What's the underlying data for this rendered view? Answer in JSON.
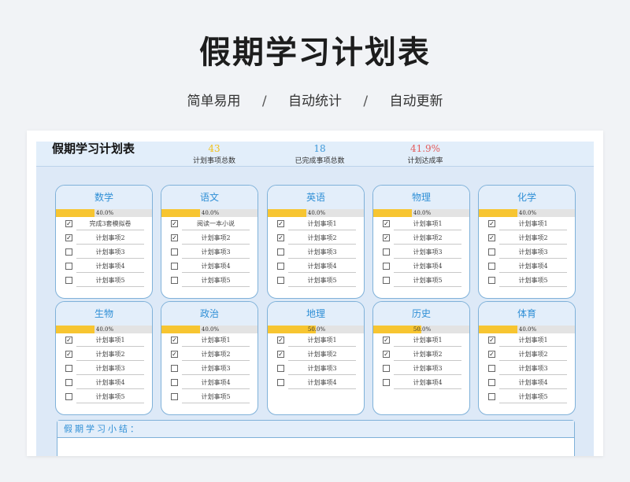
{
  "hero": {
    "title": "假期学习计划表",
    "features": [
      "简单易用",
      "自动统计",
      "自动更新"
    ],
    "separator": "/"
  },
  "sheet": {
    "title": "假期学习计划表",
    "stats": [
      {
        "value": "43",
        "label": "计划事项总数",
        "color": "#f2c018"
      },
      {
        "value": "18",
        "label": "已完成事项总数",
        "color": "#3c98d9"
      },
      {
        "value": "41.9%",
        "label": "计划达成率",
        "color": "#e35d5d"
      }
    ],
    "check_mark": "✓",
    "subjects": [
      {
        "name": "数学",
        "progress": 0.4,
        "progress_label": "40.0%",
        "items": [
          {
            "text": "完成3套模拟卷",
            "checked": true
          },
          {
            "text": "计划事项2",
            "checked": true
          },
          {
            "text": "计划事项3",
            "checked": false
          },
          {
            "text": "计划事项4",
            "checked": false
          },
          {
            "text": "计划事项5",
            "checked": false
          }
        ]
      },
      {
        "name": "语文",
        "progress": 0.4,
        "progress_label": "40.0%",
        "items": [
          {
            "text": "阅读一本小说",
            "checked": true
          },
          {
            "text": "计划事项2",
            "checked": true
          },
          {
            "text": "计划事项3",
            "checked": false
          },
          {
            "text": "计划事项4",
            "checked": false
          },
          {
            "text": "计划事项5",
            "checked": false
          }
        ]
      },
      {
        "name": "英语",
        "progress": 0.4,
        "progress_label": "40.0%",
        "items": [
          {
            "text": "计划事项1",
            "checked": true
          },
          {
            "text": "计划事项2",
            "checked": true
          },
          {
            "text": "计划事项3",
            "checked": false
          },
          {
            "text": "计划事项4",
            "checked": false
          },
          {
            "text": "计划事项5",
            "checked": false
          }
        ]
      },
      {
        "name": "物理",
        "progress": 0.4,
        "progress_label": "40.0%",
        "items": [
          {
            "text": "计划事项1",
            "checked": true
          },
          {
            "text": "计划事项2",
            "checked": true
          },
          {
            "text": "计划事项3",
            "checked": false
          },
          {
            "text": "计划事项4",
            "checked": false
          },
          {
            "text": "计划事项5",
            "checked": false
          }
        ]
      },
      {
        "name": "化学",
        "progress": 0.4,
        "progress_label": "40.0%",
        "items": [
          {
            "text": "计划事项1",
            "checked": true
          },
          {
            "text": "计划事项2",
            "checked": true
          },
          {
            "text": "计划事项3",
            "checked": false
          },
          {
            "text": "计划事项4",
            "checked": false
          },
          {
            "text": "计划事项5",
            "checked": false
          }
        ]
      },
      {
        "name": "生物",
        "progress": 0.4,
        "progress_label": "40.0%",
        "items": [
          {
            "text": "计划事项1",
            "checked": true
          },
          {
            "text": "计划事项2",
            "checked": true
          },
          {
            "text": "计划事项3",
            "checked": false
          },
          {
            "text": "计划事项4",
            "checked": false
          },
          {
            "text": "计划事项5",
            "checked": false
          }
        ]
      },
      {
        "name": "政治",
        "progress": 0.4,
        "progress_label": "40.0%",
        "items": [
          {
            "text": "计划事项1",
            "checked": true
          },
          {
            "text": "计划事项2",
            "checked": true
          },
          {
            "text": "计划事项3",
            "checked": false
          },
          {
            "text": "计划事项4",
            "checked": false
          },
          {
            "text": "计划事项5",
            "checked": false
          }
        ]
      },
      {
        "name": "地理",
        "progress": 0.5,
        "progress_label": "50.0%",
        "items": [
          {
            "text": "计划事项1",
            "checked": true
          },
          {
            "text": "计划事项2",
            "checked": true
          },
          {
            "text": "计划事项3",
            "checked": false
          },
          {
            "text": "计划事项4",
            "checked": false
          }
        ]
      },
      {
        "name": "历史",
        "progress": 0.5,
        "progress_label": "50.0%",
        "items": [
          {
            "text": "计划事项1",
            "checked": true
          },
          {
            "text": "计划事项2",
            "checked": true
          },
          {
            "text": "计划事项3",
            "checked": false
          },
          {
            "text": "计划事项4",
            "checked": false
          }
        ]
      },
      {
        "name": "体育",
        "progress": 0.4,
        "progress_label": "40.0%",
        "items": [
          {
            "text": "计划事项1",
            "checked": true
          },
          {
            "text": "计划事项2",
            "checked": true
          },
          {
            "text": "计划事项3",
            "checked": false
          },
          {
            "text": "计划事项4",
            "checked": false
          },
          {
            "text": "计划事项5",
            "checked": false
          }
        ]
      }
    ],
    "summary_label": "假期学习小结："
  }
}
